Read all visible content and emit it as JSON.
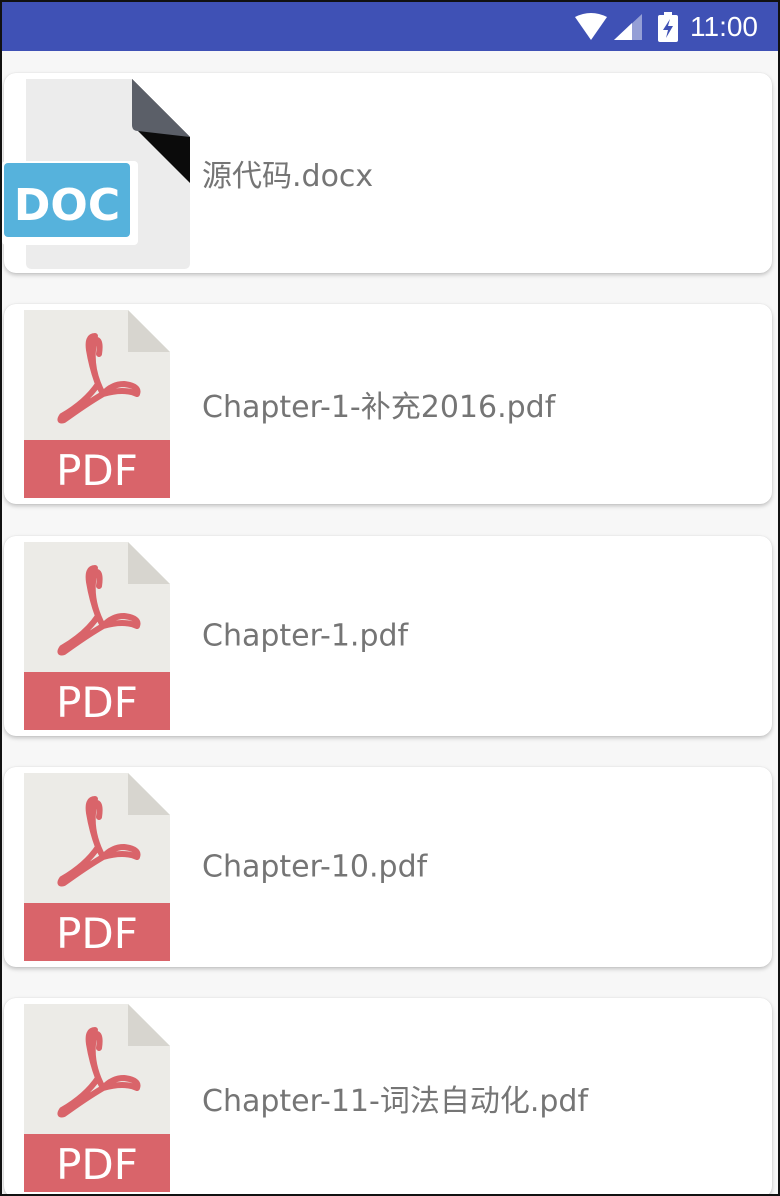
{
  "status_bar": {
    "time": "11:00",
    "icons": [
      "wifi-icon",
      "signal-icon",
      "battery-charging-icon"
    ],
    "background_color": "#3f51b5"
  },
  "files": [
    {
      "name": "源代码.docx",
      "type": "doc",
      "icon_label": "DOC",
      "icon": "doc-file-icon"
    },
    {
      "name": "Chapter-1-补充2016.pdf",
      "type": "pdf",
      "icon_label": "PDF",
      "icon": "pdf-file-icon"
    },
    {
      "name": "Chapter-1.pdf",
      "type": "pdf",
      "icon_label": "PDF",
      "icon": "pdf-file-icon"
    },
    {
      "name": "Chapter-10.pdf",
      "type": "pdf",
      "icon_label": "PDF",
      "icon": "pdf-file-icon"
    },
    {
      "name": "Chapter-11-词法自动化.pdf",
      "type": "pdf",
      "icon_label": "PDF",
      "icon": "pdf-file-icon"
    }
  ],
  "colors": {
    "pdf_accent": "#d9646a",
    "doc_accent": "#56b2dc",
    "file_name_text": "#757575"
  }
}
